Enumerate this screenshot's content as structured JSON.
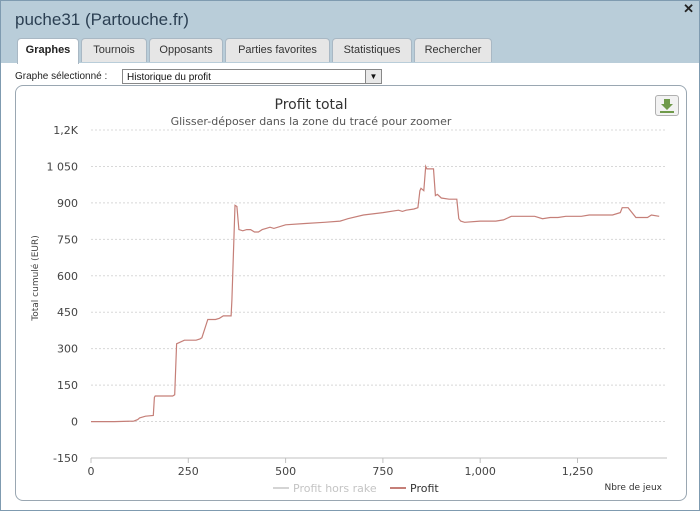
{
  "window": {
    "title": "puche31 (Partouche.fr)",
    "close_symbol": "✕"
  },
  "tabs": [
    {
      "label": "Graphes",
      "active": true
    },
    {
      "label": "Tournois",
      "active": false
    },
    {
      "label": "Opposants",
      "active": false
    },
    {
      "label": "Parties favorites",
      "active": false
    },
    {
      "label": "Statistiques",
      "active": false
    },
    {
      "label": "Rechercher",
      "active": false
    }
  ],
  "graph_selector": {
    "label": "Graphe sélectionné :",
    "selected": "Historique du profit"
  },
  "colors": {
    "profit_line": "#c57f78",
    "hors_rake_line": "#d4d4d4",
    "title_bar": "#b9cdd9"
  },
  "chart_data": {
    "type": "line",
    "title": "Profit total",
    "subtitle": "Glisser-déposer dans la zone du tracé pour zoomer",
    "ylabel": "Total cumulé (EUR)",
    "xlabel": "Nbre de jeux",
    "ylim": [
      -150,
      1200
    ],
    "xlim": [
      0,
      1480
    ],
    "yticks": [
      {
        "value": 1200,
        "label": "1,2K"
      },
      {
        "value": 1050,
        "label": "1 050"
      },
      {
        "value": 900,
        "label": "900"
      },
      {
        "value": 750,
        "label": "750"
      },
      {
        "value": 600,
        "label": "600"
      },
      {
        "value": 450,
        "label": "450"
      },
      {
        "value": 300,
        "label": "300"
      },
      {
        "value": 150,
        "label": "150"
      },
      {
        "value": 0,
        "label": "0"
      },
      {
        "value": -150,
        "label": "-150"
      }
    ],
    "xticks": [
      {
        "value": 0,
        "label": "0"
      },
      {
        "value": 250,
        "label": "250"
      },
      {
        "value": 500,
        "label": "500"
      },
      {
        "value": 750,
        "label": "750"
      },
      {
        "value": 1000,
        "label": "1,000"
      },
      {
        "value": 1250,
        "label": "1,250"
      }
    ],
    "grid": true,
    "legend_position": "bottom-center",
    "series": [
      {
        "name": "Profit hors rake",
        "values": [],
        "visible": false
      },
      {
        "name": "Profit",
        "x": [
          0,
          60,
          110,
          120,
          125,
          140,
          160,
          163,
          165,
          180,
          210,
          215,
          220,
          240,
          270,
          280,
          285,
          300,
          320,
          330,
          340,
          360,
          362,
          370,
          375,
          380,
          390,
          400,
          410,
          420,
          430,
          440,
          450,
          460,
          470,
          500,
          550,
          600,
          640,
          650,
          660,
          700,
          750,
          790,
          800,
          810,
          830,
          840,
          845,
          848,
          855,
          860,
          863,
          865,
          880,
          885,
          890,
          900,
          920,
          940,
          945,
          950,
          960,
          1000,
          1040,
          1060,
          1080,
          1120,
          1140,
          1160,
          1180,
          1200,
          1220,
          1260,
          1280,
          1300,
          1320,
          1340,
          1360,
          1365,
          1370,
          1380,
          1400,
          1410,
          1430,
          1440,
          1460
        ],
        "y": [
          0,
          0,
          2,
          8,
          15,
          22,
          25,
          100,
          105,
          105,
          105,
          110,
          320,
          335,
          335,
          340,
          345,
          420,
          420,
          425,
          435,
          435,
          500,
          890,
          885,
          790,
          785,
          790,
          790,
          780,
          780,
          790,
          795,
          800,
          795,
          810,
          815,
          820,
          825,
          830,
          835,
          850,
          860,
          870,
          865,
          870,
          875,
          880,
          950,
          960,
          950,
          1050,
          1040,
          1040,
          1040,
          930,
          935,
          920,
          915,
          915,
          835,
          825,
          820,
          825,
          825,
          830,
          845,
          845,
          845,
          835,
          840,
          840,
          845,
          845,
          850,
          850,
          850,
          850,
          860,
          880,
          880,
          880,
          840,
          840,
          840,
          850,
          845
        ]
      }
    ]
  }
}
